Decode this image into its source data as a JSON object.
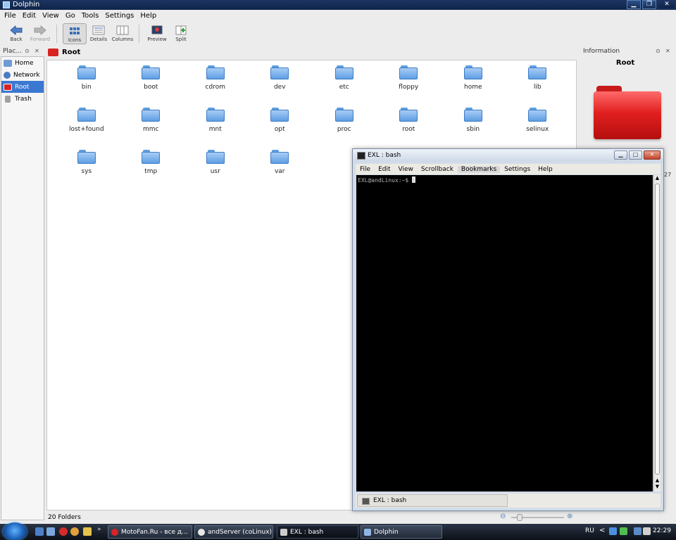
{
  "window": {
    "title": "Dolphin",
    "buttons": [
      "minimize",
      "maximize",
      "close"
    ]
  },
  "menubar": [
    "File",
    "Edit",
    "View",
    "Go",
    "Tools",
    "Settings",
    "Help"
  ],
  "toolbar": {
    "back": "Back",
    "forward": "Forward",
    "icons": "Icons",
    "details": "Details",
    "columns": "Columns",
    "preview": "Preview",
    "split": "Split"
  },
  "places": {
    "title": "Plac...",
    "items": [
      {
        "label": "Home",
        "icon": "home-icon",
        "color": "#6f9bd6"
      },
      {
        "label": "Network",
        "icon": "network-icon",
        "color": "#4a7cc4"
      },
      {
        "label": "Root",
        "icon": "root-folder-icon",
        "color": "#d92323"
      },
      {
        "label": "Trash",
        "icon": "trash-icon",
        "color": "#a0a0a0"
      }
    ]
  },
  "location": {
    "title": "Root"
  },
  "folders": [
    "bin",
    "boot",
    "cdrom",
    "dev",
    "etc",
    "floppy",
    "home",
    "lib",
    "lost+found",
    "mmc",
    "mnt",
    "opt",
    "proc",
    "root",
    "sbin",
    "selinux",
    "sys",
    "tmp",
    "usr",
    "var"
  ],
  "status": {
    "text": "20 Folders"
  },
  "info": {
    "title": "Information",
    "name": "Root",
    "clipped_text": "27"
  },
  "terminal": {
    "title": "EXL : bash",
    "menu": [
      "File",
      "Edit",
      "View",
      "Scrollback",
      "Bookmarks",
      "Settings",
      "Help"
    ],
    "highlighted_menu": "Bookmarks",
    "prompt": "EXL@andLinux:~$",
    "tab_label": "EXL : bash"
  },
  "taskbar": {
    "tasks": [
      {
        "label": "MotoFan.Ru - все д...",
        "icon_color": "#d8232a"
      },
      {
        "label": "andServer (coLinux)",
        "icon_color": "#e8e8e8"
      },
      {
        "label": "EXL : bash",
        "icon_color": "#cccccc"
      },
      {
        "label": "Dolphin",
        "icon_color": "#8fb6e6"
      }
    ],
    "quicklaunch_more": "»",
    "language": "RU",
    "tray_arrow": "<",
    "clock": "22:29"
  }
}
